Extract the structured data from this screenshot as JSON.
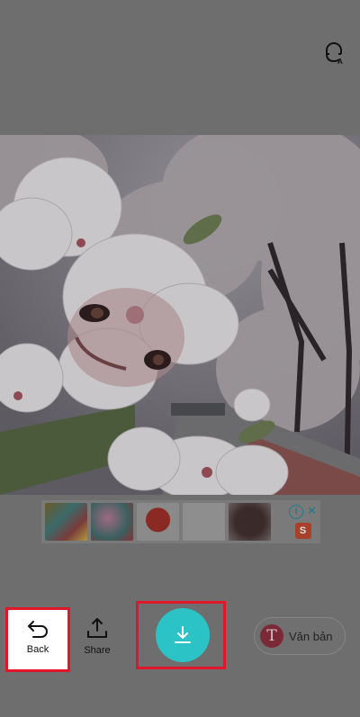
{
  "colors": {
    "overlay_bg": "#6e6e6e",
    "accent_teal": "#2cc3c6",
    "highlight_red": "#e2162a",
    "text_icon_bg": "#7a2a36"
  },
  "top": {
    "icon": "face-mask-icon"
  },
  "photo": {
    "description_icon": "photo-icon"
  },
  "ad": {
    "thumbnails": [
      "colorful-painting",
      "pink-flower-card",
      "red-table",
      "white-gadgets",
      "dark-box"
    ],
    "info_symbol": "i",
    "close_symbol": "✕",
    "shop_symbol": "S"
  },
  "toolbar": {
    "back_label": "Back",
    "share_label": "Share",
    "save_icon": "download-icon",
    "text_button_icon_letter": "T",
    "text_button_label": "Văn bản"
  }
}
